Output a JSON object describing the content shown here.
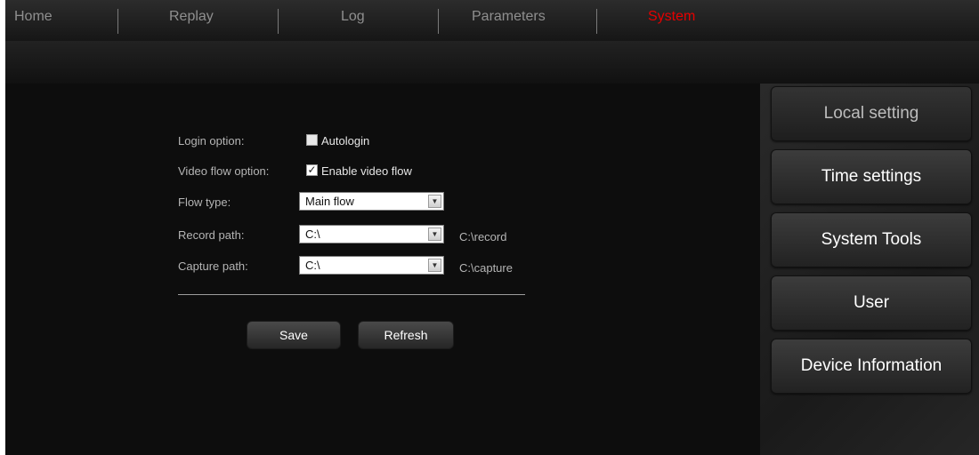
{
  "nav": {
    "items": [
      {
        "label": "Home",
        "active": false
      },
      {
        "label": "Replay",
        "active": false
      },
      {
        "label": "Log",
        "active": false
      },
      {
        "label": "Parameters",
        "active": false
      },
      {
        "label": "System",
        "active": true
      }
    ]
  },
  "form": {
    "login_option": {
      "label": "Login option:",
      "checkbox_label": "Autologin",
      "checked": false
    },
    "video_flow_option": {
      "label": "Video flow option:",
      "checkbox_label": "Enable video flow",
      "checked": true
    },
    "flow_type": {
      "label": "Flow type:",
      "value": "Main flow"
    },
    "record_path": {
      "label": "Record path:",
      "value": "C:\\",
      "path": "C:\\record"
    },
    "capture_path": {
      "label": "Capture path:",
      "value": "C:\\",
      "path": "C:\\capture"
    },
    "save_label": "Save",
    "refresh_label": "Refresh"
  },
  "sidebar": {
    "items": [
      {
        "label": "Local setting",
        "active": true
      },
      {
        "label": "Time settings",
        "active": false
      },
      {
        "label": "System Tools",
        "active": false
      },
      {
        "label": "User",
        "active": false
      },
      {
        "label": "Device Information",
        "active": false
      }
    ]
  },
  "colors": {
    "active_nav": "#e60000",
    "background": "#0d0d0d"
  }
}
